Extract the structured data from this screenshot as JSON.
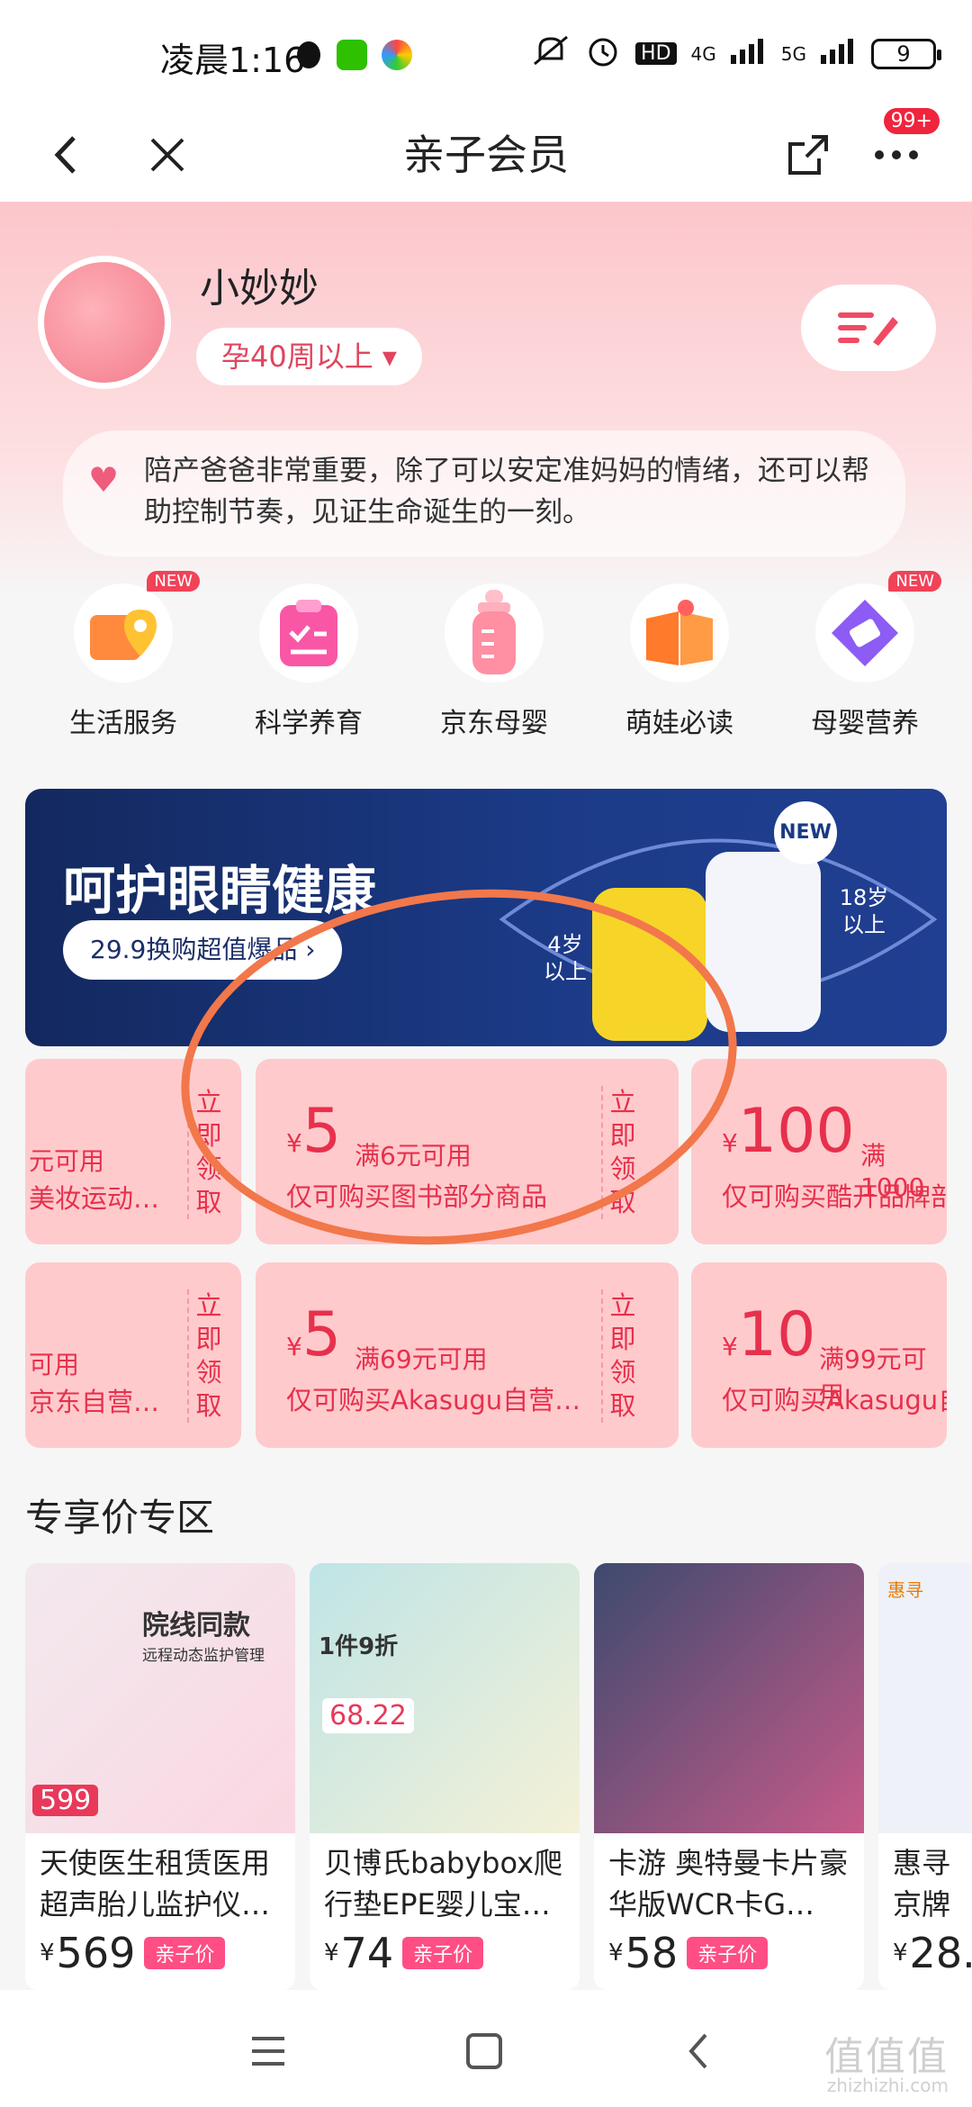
{
  "status_bar": {
    "time": "凌晨1:16",
    "network_1": "4G",
    "network_2": "5G",
    "hd": "HD",
    "battery": "9"
  },
  "nav": {
    "title": "亲子会员",
    "more_badge": "99+"
  },
  "profile": {
    "name": "小妙妙",
    "stage": "孕40周以上 ▾",
    "tip": "陪产爸爸非常重要，除了可以安定准妈妈的情绪，还可以帮助控制节奏，见证生命诞生的一刻。"
  },
  "quick_entries": [
    {
      "label": "生活服务",
      "icon": "life-service-icon",
      "badge": "NEW"
    },
    {
      "label": "科学养育",
      "icon": "clipboard-icon",
      "badge": ""
    },
    {
      "label": "京东母婴",
      "icon": "baby-bottle-icon",
      "badge": ""
    },
    {
      "label": "萌娃必读",
      "icon": "book-icon",
      "badge": ""
    },
    {
      "label": "母婴营养",
      "icon": "nutrition-icon",
      "badge": "NEW"
    }
  ],
  "banner": {
    "title": "呵护眼睛健康",
    "button": "29.9换购超值爆品 ›",
    "age_left": "4岁 以上",
    "age_right": "18岁 以上",
    "new": "NEW"
  },
  "coupons": {
    "claim": "立即领取",
    "row1": [
      {
        "amount": "",
        "cond": "元可用",
        "scope": "美妆运动…"
      },
      {
        "amount": "5",
        "cond": "满6元可用",
        "scope": "仅可购买图书部分商品"
      },
      {
        "amount": "100",
        "cond": "满1000",
        "scope": "仅可购买酷开品牌部"
      }
    ],
    "row2": [
      {
        "amount": "",
        "cond": "可用",
        "scope": "京东自营…"
      },
      {
        "amount": "5",
        "cond": "满69元可用",
        "scope": "仅可购买Akasugu自营…"
      },
      {
        "amount": "10",
        "cond": "满99元可用",
        "scope": "仅可购买Akasugu自"
      }
    ],
    "yen": "¥"
  },
  "section": {
    "title": "专享价专区"
  },
  "products": [
    {
      "name": "天使医生租赁医用超声胎儿监护仪…",
      "price": "569",
      "tag": "亲子价",
      "img_text": "院线同款",
      "img_sub": "远程动态监护管理",
      "img_price": "599"
    },
    {
      "name": "贝博氏babybox爬行垫EPE婴儿宝…",
      "price": "74",
      "tag": "亲子价",
      "img_text": "1件9折",
      "img_sub": "68.22",
      "img_price": ""
    },
    {
      "name": "卡游 奥特曼卡片豪华版WCR卡G…",
      "price": "58",
      "tag": "亲子价",
      "img_text": "",
      "img_sub": "",
      "img_price": ""
    },
    {
      "name": "惠寻 京牌婴儿",
      "price": "28.",
      "tag": "",
      "img_text": "惠寻",
      "img_sub": "",
      "img_price": ""
    }
  ],
  "watermark": {
    "main": "值值值",
    "sub": "zhizhizhi.com"
  },
  "colors": {
    "accent": "#e7304c",
    "coupon_bg": "#ffcacc",
    "banner_bg": "#1b3a86",
    "annotation": "#f2774b"
  }
}
